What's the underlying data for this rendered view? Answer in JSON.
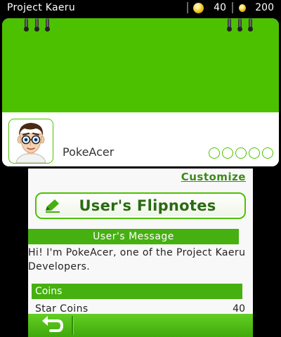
{
  "status_bar": {
    "app_title": "Project Kaeru",
    "star_coins": "40",
    "coins": "200",
    "star_coin_icon": "star-coin-icon",
    "coin_icon": "coin-icon"
  },
  "profile": {
    "username": "PokeAcer",
    "avatar": "mii-avatar",
    "page_dots": 5
  },
  "bottom": {
    "customize_label": "Customize",
    "flipnotes_button_label": "User's Flipnotes",
    "message_header": "User's Message",
    "message_text": "Hi! I'm PokeAcer, one of the Project Kaeru Developers.",
    "coins_header": "Coins",
    "star_coins_label": "Star Coins",
    "star_coins_value": "40"
  },
  "colors": {
    "accent": "#4cc100",
    "header_green": "#46b010",
    "link_green": "#3c8a1a"
  }
}
